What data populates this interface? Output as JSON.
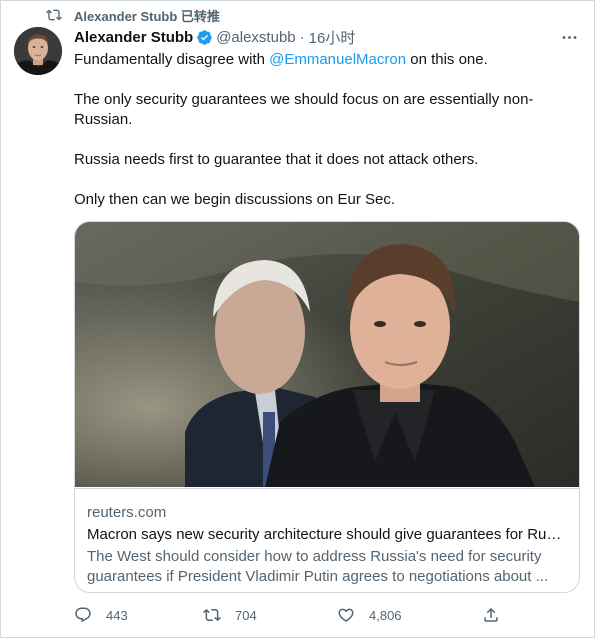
{
  "retweet_header": {
    "label": "Alexander Stubb 已转推",
    "icon": "retweet-icon"
  },
  "tweet": {
    "author_name": "Alexander Stubb",
    "handle": "@alexstubb",
    "separator": "·",
    "time": "16小时",
    "verified_color": "#1d9bf0",
    "more_label": "···",
    "text": {
      "line1_prefix": "Fundamentally disagree with ",
      "mention": "@EmmanuelMacron",
      "line1_suffix": " on this one.",
      "p2": "The only security guarantees we should focus on are essentially non-Russian.",
      "p3": "Russia needs first to guarantee that it does not attack others.",
      "p4": "Only then can we begin discussions on Eur Sec."
    }
  },
  "card": {
    "domain": "reuters.com",
    "title": "Macron says new security architecture should give guarantees for Russia",
    "description": "The West should consider how to address Russia's need for security guarantees if President Vladimir Putin agrees to negotiations about ..."
  },
  "actions": {
    "reply_count": "443",
    "retweet_count": "704",
    "like_count": "4,806"
  },
  "colors": {
    "accent": "#1d9bf0",
    "muted": "#536471",
    "border": "#cfd9de"
  }
}
